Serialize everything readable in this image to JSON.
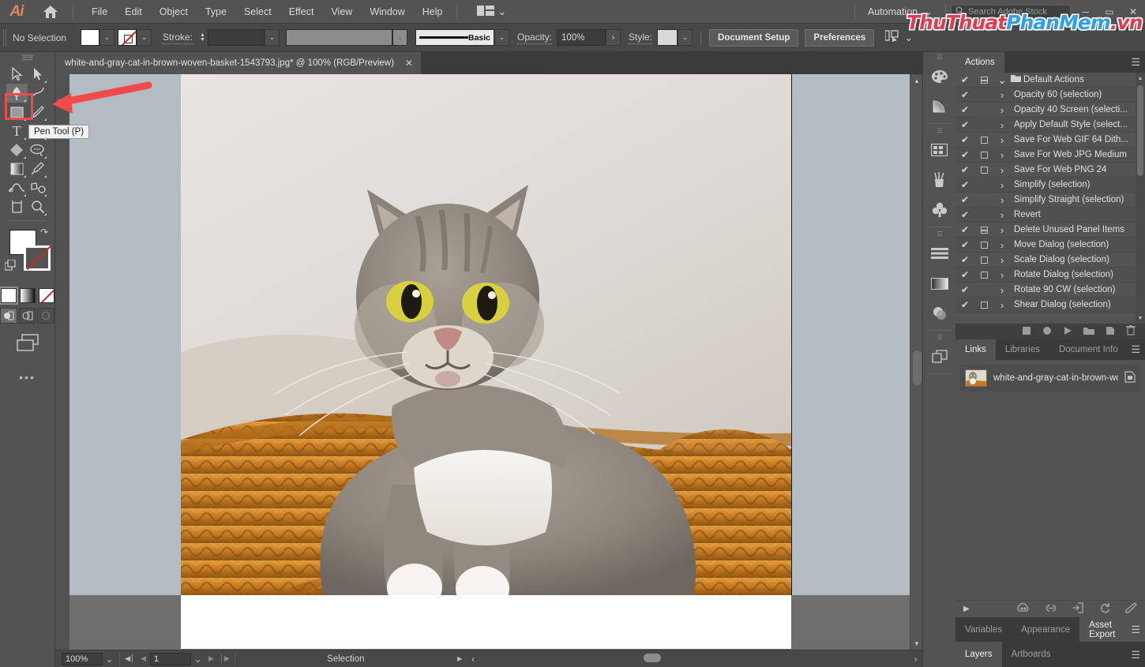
{
  "app": {
    "name": "Adobe Illustrator",
    "logo_text": "Ai",
    "home_icon": "home-icon"
  },
  "menubar": {
    "items": [
      "File",
      "Edit",
      "Object",
      "Type",
      "Select",
      "Effect",
      "View",
      "Window",
      "Help"
    ],
    "workspace_icon": "workspace-switcher-icon",
    "workspace_chevron": "⌄",
    "automation_label": "Automation",
    "automation_chevron": "⌄",
    "search_placeholder": "Search Adobe Stock",
    "search_value": "",
    "search_icon": "search-icon",
    "window_buttons": {
      "minimize": "─",
      "maximize": "▭",
      "close": "✕"
    }
  },
  "watermark": {
    "part1": "ThuThuat",
    "part2": "PhanMem",
    "part3": ".vn",
    "color_red": "#e8384f",
    "color_blue": "#2f9fe8"
  },
  "controlbar": {
    "selection_state": "No Selection",
    "fill_label": "fill-swatch",
    "fill_color": "#ffffff",
    "stroke_swatch_label": "stroke-swatch-none",
    "stroke_label": "Stroke:",
    "stroke_weight": "",
    "stroke_profile": "",
    "brush_name": "Basic",
    "opacity_label": "Opacity:",
    "opacity_value": "100%",
    "style_label": "Style:",
    "document_setup": "Document Setup",
    "preferences": "Preferences",
    "align_icon": "align-objects-icon",
    "chevron": "⌄"
  },
  "toolbar": {
    "tools": [
      {
        "name": "selection-tool",
        "glyph": "▷",
        "selected": false,
        "has_flyout": false
      },
      {
        "name": "direct-selection-tool",
        "glyph": "▶",
        "selected": false,
        "has_flyout": true
      },
      {
        "name": "pen-tool",
        "glyph": "pen",
        "selected": true,
        "has_flyout": true
      },
      {
        "name": "curvature-tool",
        "glyph": "curvature",
        "selected": false,
        "has_flyout": false
      },
      {
        "name": "rectangle-tool",
        "glyph": "■",
        "selected": false,
        "has_flyout": true
      },
      {
        "name": "paintbrush-tool",
        "glyph": "brush",
        "selected": false,
        "has_flyout": true
      },
      {
        "name": "type-tool",
        "glyph": "T",
        "selected": false,
        "has_flyout": true
      },
      {
        "name": "ellipse-lasso-tool",
        "glyph": "lasso",
        "selected": false,
        "has_flyout": true
      },
      {
        "name": "eraser-tool",
        "glyph": "eraser",
        "selected": false,
        "has_flyout": true
      },
      {
        "name": "shape-builder-tool",
        "glyph": "shapebuilder",
        "selected": false,
        "has_flyout": true
      },
      {
        "name": "gradient-tool",
        "glyph": "gradient",
        "selected": false,
        "has_flyout": true
      },
      {
        "name": "eyedropper-tool",
        "glyph": "eyedropper",
        "selected": false,
        "has_flyout": true
      },
      {
        "name": "width-tool",
        "glyph": "width",
        "selected": false,
        "has_flyout": true
      },
      {
        "name": "free-transform-tool",
        "glyph": "freetransform",
        "selected": false,
        "has_flyout": true
      },
      {
        "name": "artboard-tool",
        "glyph": "artboard",
        "selected": false,
        "has_flyout": false
      },
      {
        "name": "zoom-tool",
        "glyph": "zoom",
        "selected": false,
        "has_flyout": true
      }
    ],
    "fill_color": "#ffffff",
    "stroke_color": "none",
    "swap_icon": "swap-fill-stroke-icon",
    "default_icon": "default-fill-stroke-icon",
    "paint_modes": [
      "color-mode",
      "gradient-mode",
      "none-mode"
    ],
    "draw_modes": [
      "draw-normal",
      "draw-behind",
      "draw-inside"
    ],
    "screen_mode_icon": "change-screen-mode-icon",
    "more_tools_icon": "edit-toolbar-icon"
  },
  "tooltip": {
    "text": "Pen Tool (P)"
  },
  "annotation": {
    "arrow_color": "#f04a4a",
    "highlight_color": "#f04a4a"
  },
  "document": {
    "tab_title": "white-and-gray-cat-in-brown-woven-basket-1543793.jpg* @ 100% (RGB/Preview)",
    "close_glyph": "✕"
  },
  "canvas": {
    "artboard_bg": "#b3bbc3",
    "photo_alt": "white-and-gray-cat-in-brown-woven-basket"
  },
  "statusbar": {
    "zoom_value": "100%",
    "zoom_chevron": "⌄",
    "first_page_icon": "first-artboard-icon",
    "prev_page_icon": "prev-artboard-icon",
    "page_value": "1",
    "page_chevron": "⌄",
    "next_page_icon": "next-artboard-icon",
    "last_page_icon": "last-artboard-icon",
    "status_text": "Selection",
    "status_arrow": "▶",
    "left_chevron": "‹",
    "right_chevron": "›"
  },
  "icondock": {
    "groups": [
      [
        "color-panel-icon",
        "color-guide-icon"
      ],
      [
        "swatches-panel-icon",
        "brushes-panel-icon",
        "symbols-panel-icon"
      ],
      [
        "align-panel-icon",
        "gradient-panel-icon",
        "transparency-panel-icon"
      ],
      [
        "layers-panel-icon"
      ]
    ]
  },
  "actions_panel": {
    "tab_label": "Actions",
    "menu_icon": "panel-menu-icon",
    "rows": [
      {
        "check": true,
        "box": "dash",
        "tri": "down",
        "folder": true,
        "label": "Default Actions"
      },
      {
        "check": true,
        "box": "none",
        "tri": "right",
        "folder": false,
        "label": "Opacity 60 (selection)"
      },
      {
        "check": true,
        "box": "none",
        "tri": "right",
        "folder": false,
        "label": "Opacity 40 Screen (selecti..."
      },
      {
        "check": true,
        "box": "none",
        "tri": "right",
        "folder": false,
        "label": "Apply Default Style (select..."
      },
      {
        "check": true,
        "box": "empty",
        "tri": "right",
        "folder": false,
        "label": "Save For Web GIF 64 Dith..."
      },
      {
        "check": true,
        "box": "empty",
        "tri": "right",
        "folder": false,
        "label": "Save For Web JPG Medium"
      },
      {
        "check": true,
        "box": "empty",
        "tri": "right",
        "folder": false,
        "label": "Save For Web PNG 24"
      },
      {
        "check": true,
        "box": "none",
        "tri": "right",
        "folder": false,
        "label": "Simplify (selection)"
      },
      {
        "check": true,
        "box": "none",
        "tri": "right",
        "folder": false,
        "label": "Simplify Straight (selection)"
      },
      {
        "check": true,
        "box": "none",
        "tri": "right",
        "folder": false,
        "label": "Revert"
      },
      {
        "check": true,
        "box": "dash",
        "tri": "right",
        "folder": false,
        "label": "Delete Unused Panel Items"
      },
      {
        "check": true,
        "box": "empty",
        "tri": "right",
        "folder": false,
        "label": "Move Dialog (selection)"
      },
      {
        "check": true,
        "box": "empty",
        "tri": "right",
        "folder": false,
        "label": "Scale Dialog (selection)"
      },
      {
        "check": true,
        "box": "empty",
        "tri": "right",
        "folder": false,
        "label": "Rotate Dialog (selection)"
      },
      {
        "check": true,
        "box": "none",
        "tri": "right",
        "folder": false,
        "label": "Rotate 90 CW (selection)"
      },
      {
        "check": true,
        "box": "empty",
        "tri": "right",
        "folder": false,
        "label": "Shear Dialog (selection)"
      }
    ],
    "footer_buttons": [
      "stop-playing-icon",
      "begin-recording-icon",
      "play-selection-icon",
      "create-new-set-icon",
      "create-new-action-icon",
      "delete-selection-icon"
    ]
  },
  "links_panel": {
    "tabs": [
      {
        "label": "Links",
        "active": true
      },
      {
        "label": "Libraries",
        "active": false
      },
      {
        "label": "Document Info",
        "active": false
      }
    ],
    "menu_icon": "panel-menu-icon",
    "item": {
      "name": "white-and-gray-cat-in-brown-wo...",
      "thumb": "link-thumbnail",
      "status_icon": "embedded-file-icon"
    },
    "footer": {
      "expand_icon": "expand-link-info-icon",
      "buttons": [
        "relink-from-cc-libraries-icon",
        "relink-icon",
        "go-to-link-icon",
        "update-link-icon",
        "edit-original-icon"
      ]
    }
  },
  "variables_panel": {
    "tabs": [
      {
        "label": "Variables",
        "active": false
      },
      {
        "label": "Appearance",
        "active": false
      },
      {
        "label": "Asset Export",
        "active": true
      }
    ],
    "menu_icon": "panel-menu-icon"
  },
  "layers_panel": {
    "tabs": [
      {
        "label": "Layers",
        "active": true
      },
      {
        "label": "Artboards",
        "active": false
      }
    ],
    "menu_icon": "panel-menu-icon"
  }
}
